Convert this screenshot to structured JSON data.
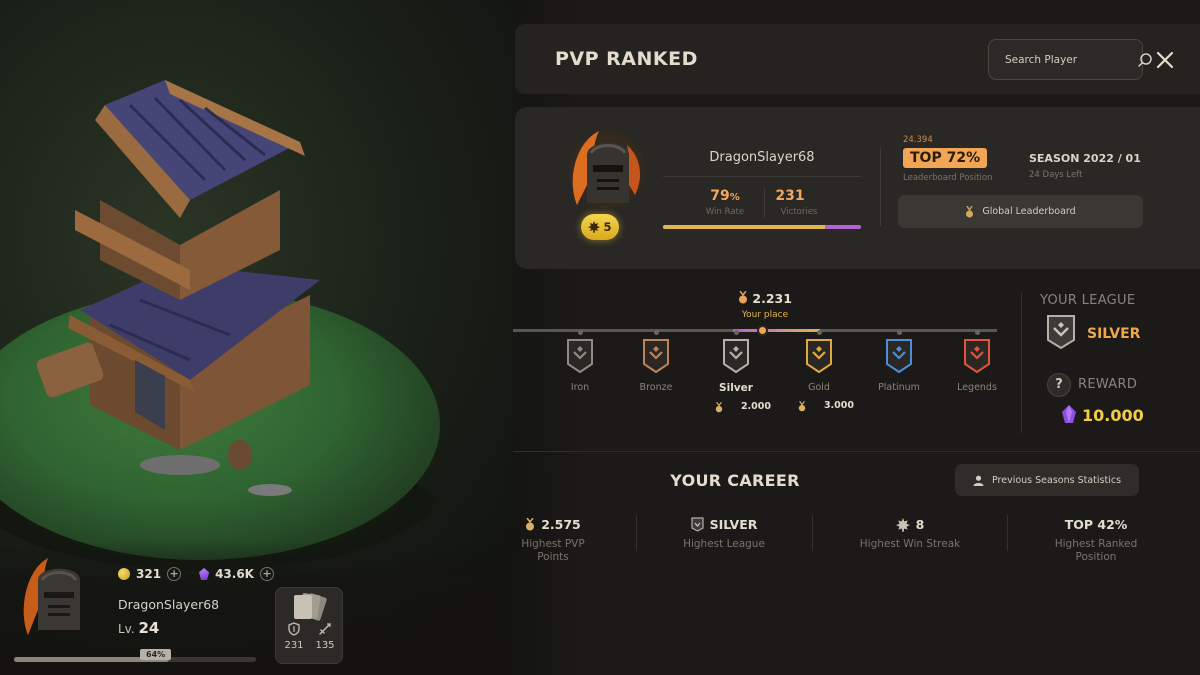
{
  "header": {
    "title": "PVP RANKED",
    "search_placeholder": "Search Player"
  },
  "profile": {
    "name": "DragonSlayer68",
    "rank_level": "5",
    "win_rate": "79",
    "win_rate_unit": "%",
    "win_rate_label": "Win Rate",
    "victories": "231",
    "victories_label": "Victories",
    "win_rate_fraction": 0.82
  },
  "leaderboard": {
    "count": "24.394",
    "top_badge": "TOP 72%",
    "position_label": "Leaderboard Position",
    "season": "SEASON 2022 / 01",
    "days_left": "24 Days Left",
    "global_button": "Global Leaderboard"
  },
  "league_track": {
    "place_value": "2.231",
    "place_label": "Your place",
    "tiers": [
      {
        "name": "Iron",
        "color": "#8f8a84"
      },
      {
        "name": "Bronze",
        "color": "#c08357"
      },
      {
        "name": "Silver",
        "color": "#b4b0aa",
        "requirement": "2.000"
      },
      {
        "name": "Gold",
        "color": "#e0a93e",
        "requirement": "3.000"
      },
      {
        "name": "Platinum",
        "color": "#4a8fd8"
      },
      {
        "name": "Legends",
        "color": "#e2553c"
      }
    ]
  },
  "your_league": {
    "label": "YOUR LEAGUE",
    "value": "SILVER",
    "reward_label": "REWARD",
    "reward_value": "10.000"
  },
  "career": {
    "title": "YOUR CAREER",
    "prev_button": "Previous Seasons Statistics",
    "stats": [
      {
        "value": "2.575",
        "label_1": "Highest  PVP",
        "label_2": "Points",
        "icon": "medal-icon"
      },
      {
        "value": "SILVER",
        "label_1": "Highest League",
        "label_2": "",
        "icon": "silver-league-icon"
      },
      {
        "value": "8",
        "label_1": "Highest Win Streak",
        "label_2": "",
        "icon": "maple-leaf-icon"
      },
      {
        "value": "TOP 42%",
        "label_1": "Highest Ranked",
        "label_2": "Position",
        "icon": ""
      }
    ]
  },
  "player_hud": {
    "coins": "321",
    "gems": "43.6K",
    "name": "DragonSlayer68",
    "level_prefix": "Lv.",
    "level": "24",
    "xp_percent": "64%",
    "xp_fraction": 0.64,
    "defense": "231",
    "attack": "135"
  },
  "colors": {
    "accent_orange": "#f1a555",
    "gold": "#f3cd43",
    "purple": "#b163d6",
    "panel_bg": "#1b1a18"
  }
}
